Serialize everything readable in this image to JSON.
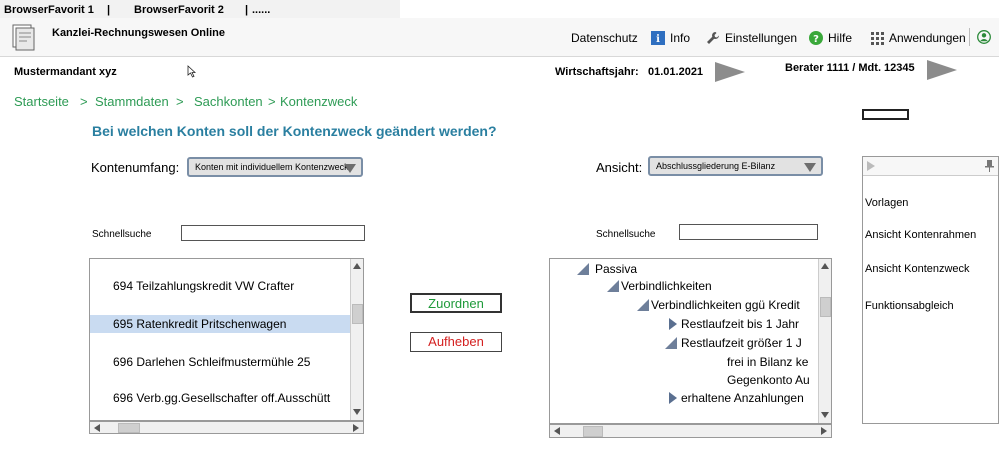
{
  "favorites": {
    "items": [
      "BrowserFavorit 1",
      "BrowserFavorit 2",
      "......"
    ],
    "separator": "|"
  },
  "app": {
    "title": "Kanzlei-Rechnungswesen  Online"
  },
  "topnav": {
    "datenschutz": "Datenschutz",
    "info": "Info",
    "einstellungen": "Einstellungen",
    "hilfe": "Hilfe",
    "anwendungen": "Anwendungen"
  },
  "context": {
    "mandant": "Mustermandant  xyz",
    "wirtschaftsjahr_label": "Wirtschaftsjahr:",
    "wirtschaftsjahr_value": "01.01.2021",
    "berater": "Berater 1111 / Mdt. 12345"
  },
  "breadcrumb": [
    "Startseite",
    "Stammdaten",
    "Sachkonten",
    "Kontenzweck"
  ],
  "breadcrumb_sep": ">",
  "question": "Bei welchen Konten soll der Kontenzweck geändert werden?",
  "left": {
    "umfang_label": "Kontenumfang:",
    "umfang_value": "Konten mit individuellem Kontenzweck",
    "search_label": "Schnellsuche",
    "search_value": "",
    "accounts": [
      "694 Teilzahlungskredit VW Crafter",
      "695 Ratenkredit Pritschenwagen",
      "696 Darlehen Schleifmustermühle 25",
      "696 Verb.gg.Gesellschafter off.Ausschütt"
    ],
    "selected_index": 1
  },
  "actions": {
    "zuordnen": "Zuordnen",
    "aufheben": "Aufheben"
  },
  "colors": {
    "zuordnen": "#1f9a3a",
    "aufheben": "#d42020",
    "breadcrumb": "#2e9b55",
    "question": "#2a7fa0"
  },
  "right": {
    "ansicht_label": "Ansicht:",
    "ansicht_value": "Abschlussgliederung E-Bilanz",
    "search_label": "Schnellsuche",
    "search_value": "",
    "tree": {
      "passiva": "Passiva",
      "verbindlichkeiten": "Verbindlichkeiten",
      "verb_kredit": "Verbindlichkeiten ggü Kredit",
      "rest1": "Restlaufzeit bis 1 Jahr",
      "rest2": "Restlaufzeit größer 1 J",
      "frei": "frei in Bilanz ke",
      "gegenkonto": "Gegenkonto Au",
      "anzahlungen": "erhaltene Anzahlungen"
    }
  },
  "side_panel": {
    "items": [
      "Vorlagen",
      "Ansicht Kontenrahmen",
      "Ansicht Kontenzweck",
      "Funktionsabgleich"
    ],
    "pin_icon": "pin-icon",
    "expand_icon": "play-icon"
  }
}
